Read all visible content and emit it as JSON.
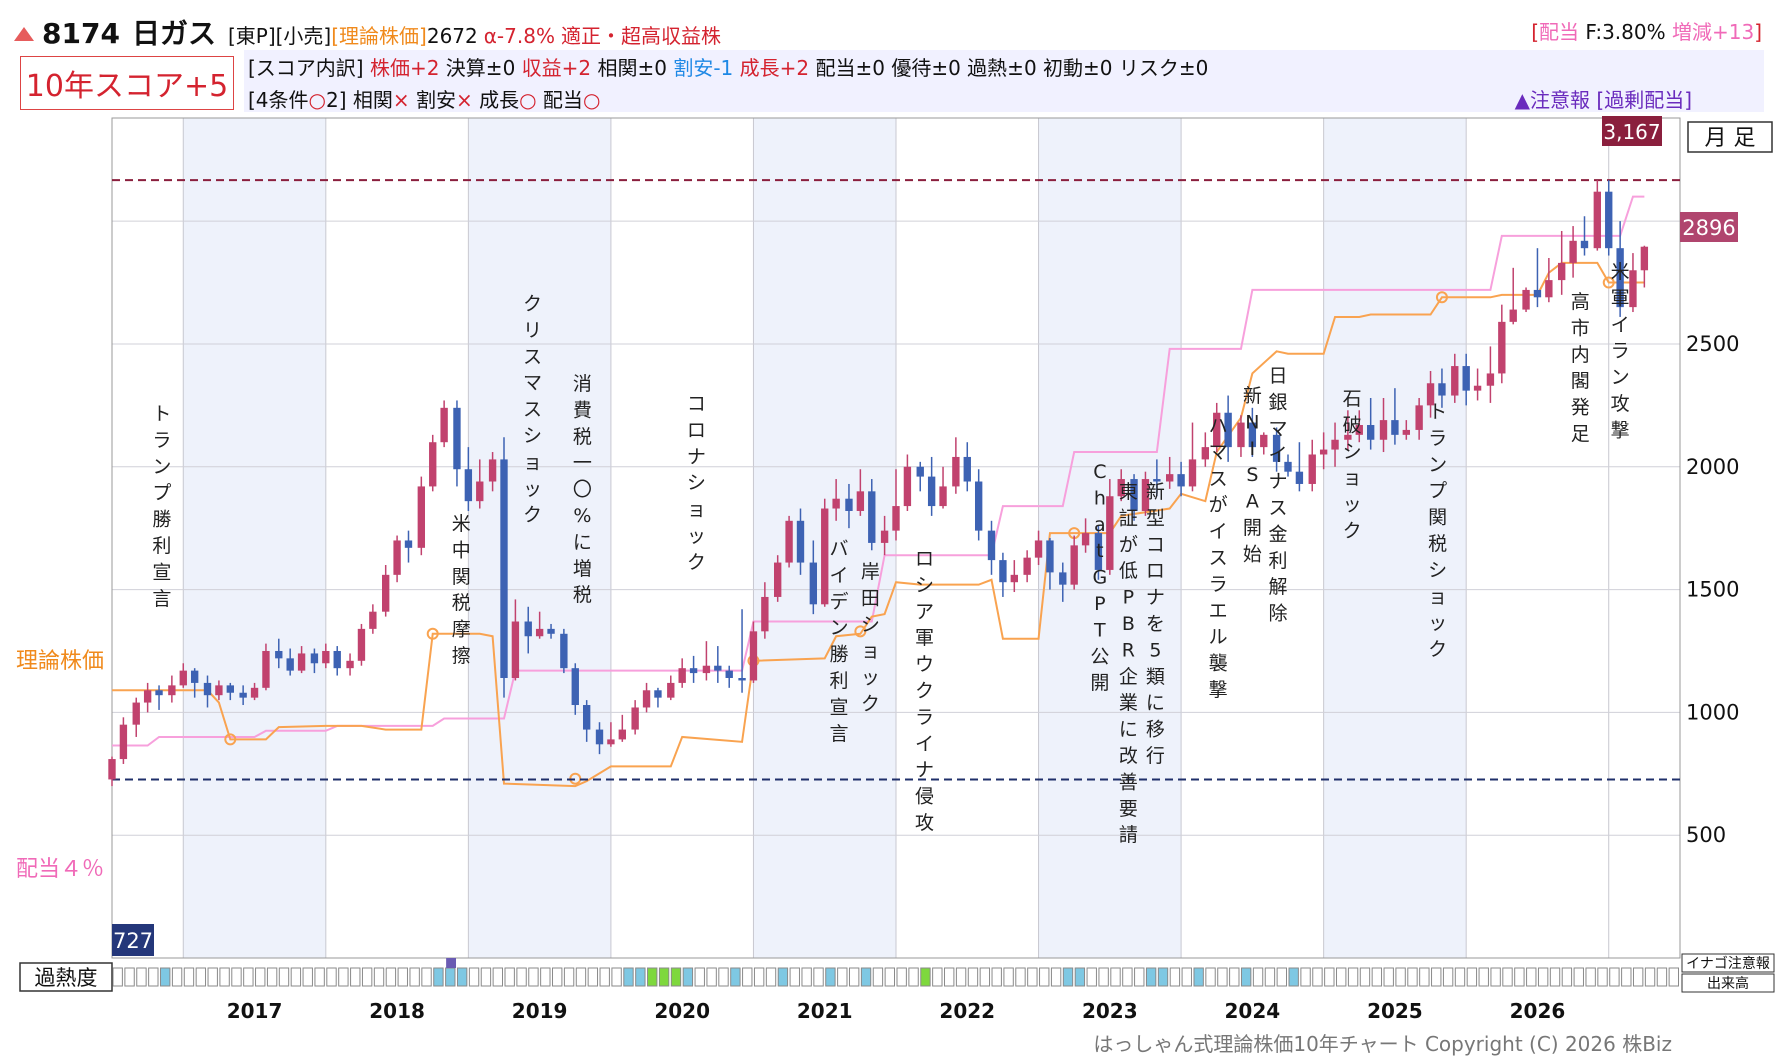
{
  "header": {
    "code": "8174",
    "name": "日ガス",
    "market": "[東P][小売]",
    "theory_label": "[理論株価]",
    "theory_value": "2672",
    "alpha": "α-7.8%",
    "verdict": "適正・超高収益株",
    "div_open": "[",
    "div_label": "配当",
    "div_value": "F:3.80%",
    "div_change": "増減+13",
    "div_close": "]",
    "score": "10年スコア+5",
    "detail_prefix": "[スコア内訳]",
    "detail_items": [
      {
        "text": "株価+2",
        "color": "#d4232f"
      },
      {
        "text": "決算±0",
        "color": "#111111"
      },
      {
        "text": "収益+2",
        "color": "#d4232f"
      },
      {
        "text": "相関±0",
        "color": "#111111"
      },
      {
        "text": "割安-1",
        "color": "#1e88e5"
      },
      {
        "text": "成長+2",
        "color": "#d4232f"
      },
      {
        "text": "配当±0",
        "color": "#111111"
      },
      {
        "text": "優待±0",
        "color": "#111111"
      },
      {
        "text": "過熱±0",
        "color": "#111111"
      },
      {
        "text": "初動±0",
        "color": "#111111"
      },
      {
        "text": "リスク±0",
        "color": "#111111"
      }
    ],
    "cond_prefix": "[4条件",
    "cond_count": "2]",
    "cond_items": [
      {
        "label": "相関",
        "mark": "×",
        "ok": false
      },
      {
        "label": "割安",
        "mark": "×",
        "ok": false
      },
      {
        "label": "成長",
        "mark": "",
        "ok": true
      },
      {
        "label": "配当",
        "mark": "",
        "ok": true
      }
    ],
    "warning": "▲注意報",
    "warning_note": "[過剰配当]"
  },
  "chart_data": {
    "type": "candlestick",
    "period_label": "月 足",
    "x_ticks": [
      "2017",
      "2018",
      "2019",
      "2020",
      "2021",
      "2022",
      "2023",
      "2024",
      "2025",
      "2026"
    ],
    "y_ticks": [
      500,
      1000,
      1500,
      2000,
      2500
    ],
    "ylim": [
      0,
      3420
    ],
    "high_value": 3167,
    "high_label": "3,167",
    "low_value": 727,
    "low_label": "727",
    "last_price": 2896,
    "last_label": "2896",
    "theory_label": "理論株価",
    "dividend_label": "配当４％",
    "heat_label": "過熱度",
    "caution_label": "イナゴ注意報",
    "volume_label": "出来高",
    "candles": [
      [
        2016.5,
        727,
        810,
        700,
        820
      ],
      [
        2016.58,
        810,
        950,
        790,
        980
      ],
      [
        2016.67,
        950,
        1040,
        900,
        1060
      ],
      [
        2016.75,
        1040,
        1090,
        1000,
        1120
      ],
      [
        2016.83,
        1090,
        1070,
        1010,
        1110
      ],
      [
        2016.92,
        1070,
        1110,
        1040,
        1150
      ],
      [
        2017.0,
        1110,
        1170,
        1100,
        1200
      ],
      [
        2017.08,
        1170,
        1120,
        1060,
        1180
      ],
      [
        2017.17,
        1120,
        1070,
        1020,
        1150
      ],
      [
        2017.25,
        1070,
        1110,
        1050,
        1130
      ],
      [
        2017.33,
        1110,
        1080,
        1050,
        1120
      ],
      [
        2017.42,
        1080,
        1060,
        1030,
        1110
      ],
      [
        2017.5,
        1060,
        1100,
        1050,
        1120
      ],
      [
        2017.58,
        1100,
        1250,
        1090,
        1280
      ],
      [
        2017.67,
        1250,
        1220,
        1180,
        1300
      ],
      [
        2017.75,
        1220,
        1170,
        1150,
        1260
      ],
      [
        2017.83,
        1170,
        1240,
        1160,
        1270
      ],
      [
        2017.92,
        1240,
        1200,
        1160,
        1260
      ],
      [
        2018.0,
        1200,
        1250,
        1180,
        1280
      ],
      [
        2018.08,
        1250,
        1180,
        1150,
        1270
      ],
      [
        2018.17,
        1180,
        1210,
        1150,
        1240
      ],
      [
        2018.25,
        1210,
        1340,
        1190,
        1360
      ],
      [
        2018.33,
        1340,
        1410,
        1320,
        1440
      ],
      [
        2018.42,
        1410,
        1560,
        1390,
        1600
      ],
      [
        2018.5,
        1560,
        1700,
        1530,
        1720
      ],
      [
        2018.58,
        1700,
        1670,
        1610,
        1740
      ],
      [
        2018.67,
        1670,
        1920,
        1640,
        1960
      ],
      [
        2018.75,
        1920,
        2100,
        1900,
        2130
      ],
      [
        2018.83,
        2100,
        2240,
        2080,
        2270
      ],
      [
        2018.92,
        2240,
        1990,
        1920,
        2270
      ],
      [
        2019.0,
        1990,
        1860,
        1820,
        2080
      ],
      [
        2019.08,
        1860,
        1940,
        1830,
        2030
      ],
      [
        2019.17,
        1940,
        2030,
        1900,
        2060
      ],
      [
        2019.25,
        2030,
        1140,
        1060,
        2120
      ],
      [
        2019.33,
        1140,
        1370,
        1130,
        1460
      ],
      [
        2019.42,
        1370,
        1310,
        1240,
        1430
      ],
      [
        2019.5,
        1310,
        1340,
        1300,
        1410
      ],
      [
        2019.58,
        1340,
        1320,
        1300,
        1360
      ],
      [
        2019.67,
        1320,
        1180,
        1160,
        1340
      ],
      [
        2019.75,
        1180,
        1030,
        990,
        1200
      ],
      [
        2019.83,
        1030,
        930,
        880,
        1050
      ],
      [
        2019.92,
        930,
        870,
        830,
        960
      ],
      [
        2020.0,
        870,
        890,
        860,
        960
      ],
      [
        2020.08,
        890,
        930,
        880,
        990
      ],
      [
        2020.17,
        930,
        1020,
        910,
        1050
      ],
      [
        2020.25,
        1020,
        1090,
        1000,
        1120
      ],
      [
        2020.33,
        1090,
        1060,
        1020,
        1100
      ],
      [
        2020.42,
        1060,
        1120,
        1050,
        1150
      ],
      [
        2020.5,
        1120,
        1180,
        1100,
        1220
      ],
      [
        2020.58,
        1180,
        1160,
        1120,
        1230
      ],
      [
        2020.67,
        1160,
        1190,
        1130,
        1290
      ],
      [
        2020.75,
        1190,
        1170,
        1120,
        1270
      ],
      [
        2020.83,
        1170,
        1140,
        1100,
        1190
      ],
      [
        2020.92,
        1140,
        1130,
        1080,
        1420
      ],
      [
        2021.0,
        1130,
        1330,
        1120,
        1370
      ],
      [
        2021.08,
        1330,
        1470,
        1300,
        1530
      ],
      [
        2021.17,
        1470,
        1610,
        1450,
        1640
      ],
      [
        2021.25,
        1610,
        1780,
        1590,
        1800
      ],
      [
        2021.33,
        1780,
        1610,
        1560,
        1830
      ],
      [
        2021.42,
        1610,
        1440,
        1400,
        1700
      ],
      [
        2021.5,
        1440,
        1830,
        1430,
        1870
      ],
      [
        2021.58,
        1830,
        1870,
        1780,
        1950
      ],
      [
        2021.67,
        1870,
        1820,
        1750,
        1930
      ],
      [
        2021.75,
        1820,
        1900,
        1800,
        1990
      ],
      [
        2021.83,
        1900,
        1690,
        1660,
        1950
      ],
      [
        2021.92,
        1690,
        1740,
        1640,
        1800
      ],
      [
        2022.0,
        1740,
        1840,
        1700,
        1990
      ],
      [
        2022.08,
        1840,
        2000,
        1820,
        2050
      ],
      [
        2022.17,
        2000,
        1960,
        1900,
        2020
      ],
      [
        2022.25,
        1960,
        1840,
        1800,
        2040
      ],
      [
        2022.33,
        1840,
        1920,
        1830,
        2000
      ],
      [
        2022.42,
        1920,
        2040,
        1890,
        2120
      ],
      [
        2022.5,
        2040,
        1940,
        1900,
        2100
      ],
      [
        2022.58,
        1940,
        1740,
        1700,
        1990
      ],
      [
        2022.67,
        1740,
        1620,
        1560,
        1780
      ],
      [
        2022.75,
        1620,
        1530,
        1470,
        1650
      ],
      [
        2022.83,
        1530,
        1560,
        1490,
        1620
      ],
      [
        2022.92,
        1560,
        1630,
        1530,
        1660
      ],
      [
        2023.0,
        1630,
        1700,
        1600,
        1740
      ],
      [
        2023.08,
        1700,
        1570,
        1500,
        1710
      ],
      [
        2023.17,
        1570,
        1520,
        1450,
        1610
      ],
      [
        2023.25,
        1520,
        1680,
        1500,
        1720
      ],
      [
        2023.33,
        1680,
        1730,
        1650,
        1790
      ],
      [
        2023.42,
        1730,
        1580,
        1540,
        1760
      ],
      [
        2023.5,
        1580,
        1880,
        1560,
        1950
      ],
      [
        2023.58,
        1880,
        1950,
        1860,
        1990
      ],
      [
        2023.67,
        1950,
        1820,
        1780,
        1970
      ],
      [
        2023.75,
        1820,
        1950,
        1800,
        1980
      ],
      [
        2023.83,
        1950,
        1940,
        1880,
        2030
      ],
      [
        2023.92,
        1940,
        1970,
        1910,
        2040
      ],
      [
        2024.0,
        1970,
        1920,
        1880,
        2020
      ],
      [
        2024.08,
        1920,
        2030,
        1900,
        2180
      ],
      [
        2024.17,
        2030,
        2080,
        2000,
        2140
      ],
      [
        2024.25,
        2080,
        2220,
        2060,
        2260
      ],
      [
        2024.33,
        2220,
        2080,
        2020,
        2290
      ],
      [
        2024.42,
        2080,
        2180,
        2040,
        2210
      ],
      [
        2024.5,
        2180,
        2080,
        2040,
        2240
      ],
      [
        2024.58,
        2080,
        2130,
        2050,
        2140
      ],
      [
        2024.67,
        2130,
        2020,
        1980,
        2160
      ],
      [
        2024.75,
        2020,
        1980,
        1960,
        2050
      ],
      [
        2024.83,
        1980,
        1930,
        1900,
        2100
      ],
      [
        2024.92,
        1930,
        2050,
        1900,
        2110
      ],
      [
        2025.0,
        2050,
        2070,
        1990,
        2140
      ],
      [
        2025.08,
        2070,
        2110,
        2000,
        2180
      ],
      [
        2025.17,
        2110,
        2130,
        2070,
        2230
      ],
      [
        2025.25,
        2130,
        2170,
        2100,
        2230
      ],
      [
        2025.33,
        2170,
        2110,
        2070,
        2280
      ],
      [
        2025.42,
        2110,
        2190,
        2060,
        2280
      ],
      [
        2025.5,
        2190,
        2130,
        2090,
        2320
      ],
      [
        2025.58,
        2130,
        2150,
        2110,
        2190
      ],
      [
        2025.67,
        2150,
        2250,
        2110,
        2280
      ],
      [
        2025.75,
        2250,
        2340,
        2200,
        2390
      ],
      [
        2025.83,
        2340,
        2290,
        2240,
        2400
      ],
      [
        2025.92,
        2290,
        2410,
        2260,
        2460
      ],
      [
        2026.0,
        2410,
        2310,
        2250,
        2460
      ],
      [
        2026.08,
        2310,
        2330,
        2270,
        2400
      ],
      [
        2026.17,
        2330,
        2380,
        2260,
        2490
      ],
      [
        2026.25,
        2380,
        2590,
        2340,
        2660
      ],
      [
        2026.33,
        2590,
        2640,
        2580,
        2810
      ],
      [
        2026.42,
        2640,
        2720,
        2630,
        2730
      ],
      [
        2026.5,
        2720,
        2690,
        2650,
        2890
      ],
      [
        2026.58,
        2690,
        2760,
        2670,
        2850
      ],
      [
        2026.67,
        2760,
        2830,
        2700,
        2960
      ],
      [
        2026.75,
        2830,
        2920,
        2770,
        2980
      ],
      [
        2026.83,
        2920,
        2890,
        2860,
        3020
      ],
      [
        2026.92,
        2890,
        3120,
        2880,
        3167
      ],
      [
        2027.0,
        3120,
        2890,
        2860,
        3167
      ],
      [
        2027.08,
        2890,
        2650,
        2610,
        3000
      ],
      [
        2027.17,
        2650,
        2800,
        2630,
        2870
      ],
      [
        2027.25,
        2800,
        2896,
        2730,
        2900
      ]
    ]
  }
}
